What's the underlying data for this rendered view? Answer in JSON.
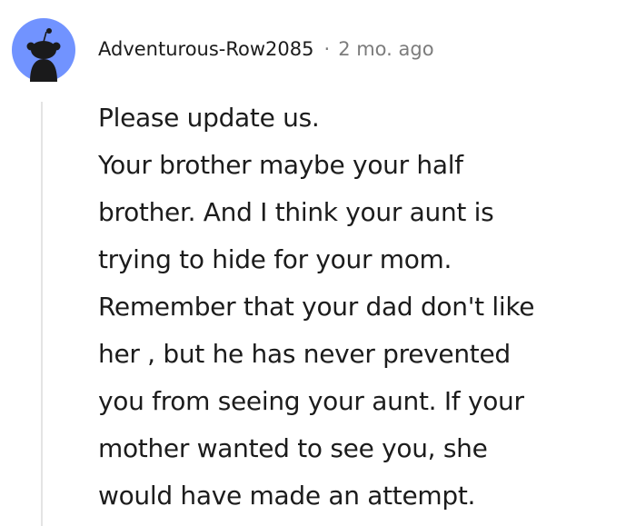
{
  "comment": {
    "author": "Adventurous-Row2085",
    "separator": "·",
    "timestamp": "2 mo. ago",
    "avatar_icon": "reddit-snoo-avatar-icon",
    "avatar_color": "#7193ff",
    "body_lines": [
      "Please update us.",
      "Your brother maybe your half",
      "brother. And I think your aunt is",
      "trying to hide for your mom.",
      "Remember that your dad don't like",
      "her , but he has never prevented",
      "you from seeing your aunt. If your",
      "mother wanted to see you, she",
      "would have made an attempt."
    ]
  }
}
